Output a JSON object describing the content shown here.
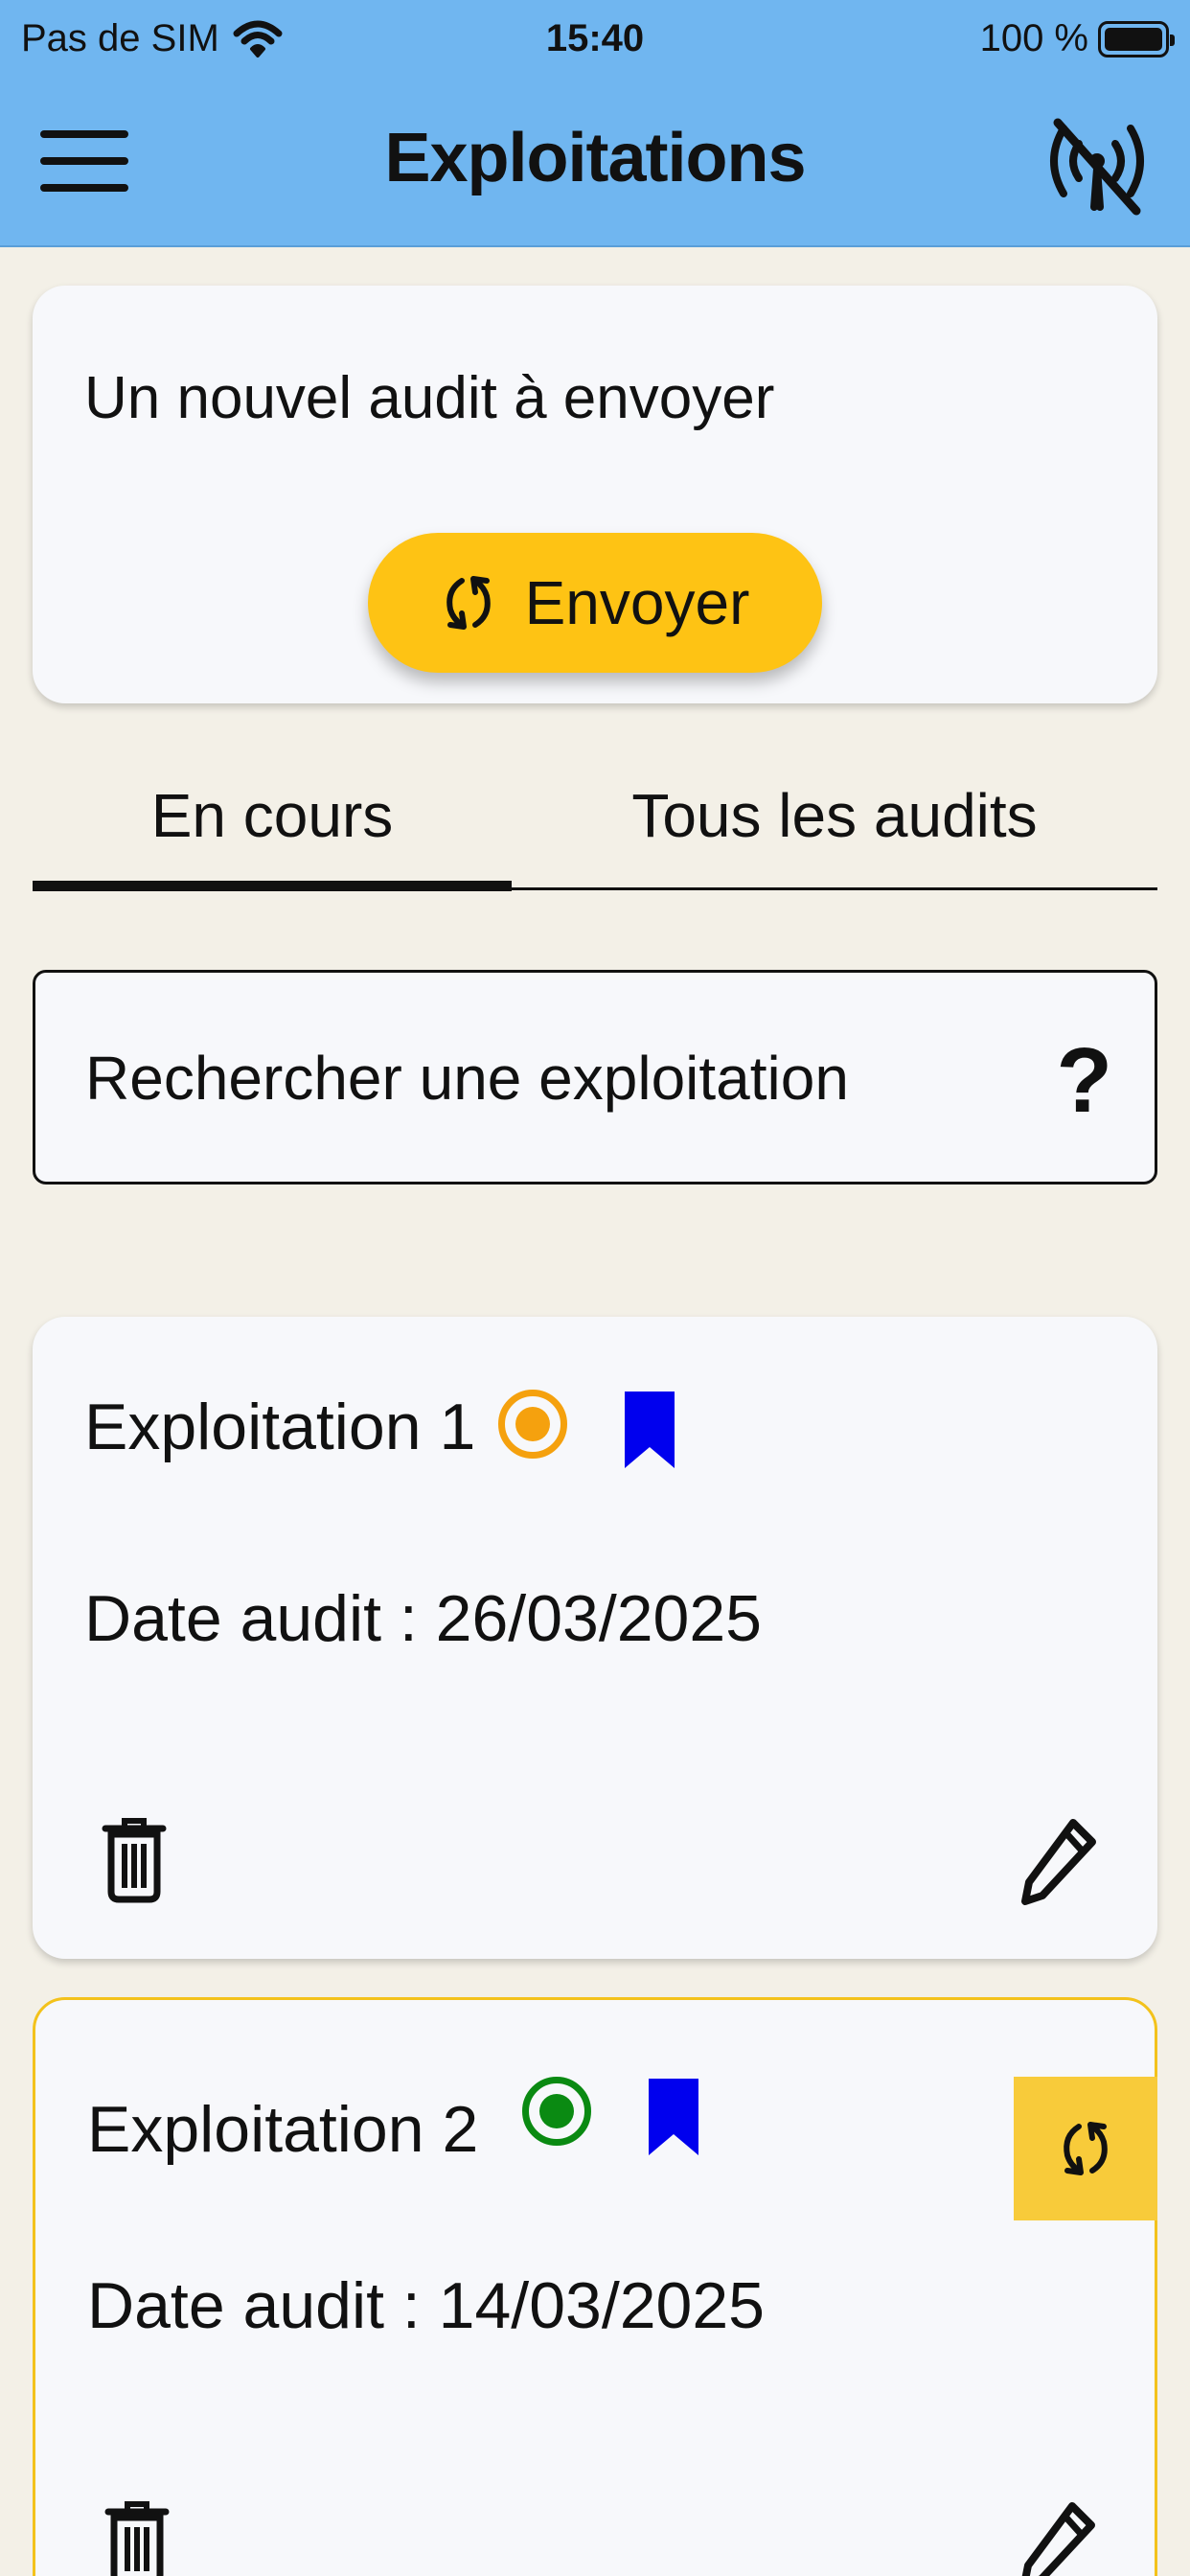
{
  "status_bar": {
    "carrier": "Pas de SIM",
    "time": "15:40",
    "battery": "100 %"
  },
  "app_bar": {
    "title": "Exploitations",
    "menu_icon": "hamburger-menu-icon",
    "offline_icon": "signal-off-icon"
  },
  "pending": {
    "message": "Un nouvel audit à envoyer",
    "send_label": "Envoyer",
    "send_icon": "sync-icon"
  },
  "tabs": [
    {
      "label": "En cours",
      "active": true
    },
    {
      "label": "Tous les audits",
      "active": false
    }
  ],
  "search": {
    "placeholder": "Rechercher une exploitation",
    "help_label": "?"
  },
  "exploitations": [
    {
      "name": "Exploitation 1",
      "date": "Date audit : 26/03/2025",
      "status_color": "#f5a10e",
      "bookmark_color": "#0000ee",
      "pending_sync": false
    },
    {
      "name": "Exploitation 2",
      "date": "Date audit : 14/03/2025",
      "status_color": "#0a8a12",
      "bookmark_color": "#0000ee",
      "pending_sync": true
    }
  ],
  "colors": {
    "header": "#70b6f0",
    "background": "#f3f0e7",
    "accent": "#fec314",
    "card": "#f7f8fb"
  }
}
